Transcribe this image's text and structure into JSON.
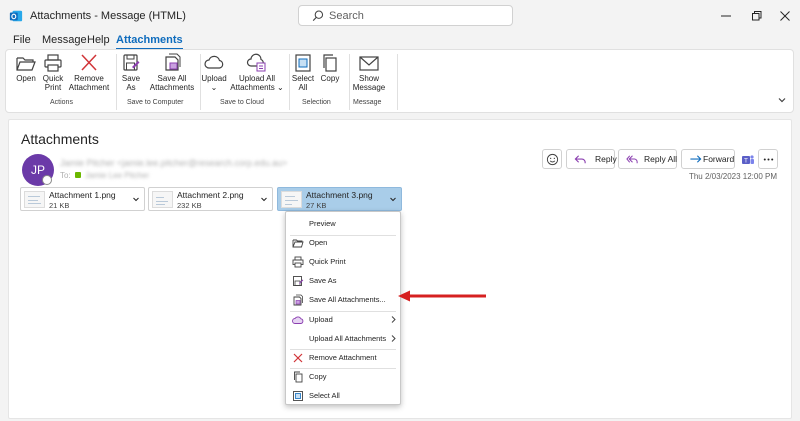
{
  "titlebar": {
    "window_title": "Attachments - Message (HTML)",
    "search_placeholder": "Search",
    "app_icon": "outlook-icon",
    "window_controls": [
      "minimize-icon",
      "restore-icon",
      "close-icon"
    ]
  },
  "menu": {
    "tabs": [
      {
        "label": "File",
        "active": false
      },
      {
        "label": "Message",
        "active": false
      },
      {
        "label": "Help",
        "active": false
      },
      {
        "label": "Attachments",
        "active": true
      }
    ]
  },
  "ribbon": {
    "groups": [
      {
        "label": "Actions",
        "buttons": [
          {
            "label_lines": [
              "Open"
            ],
            "icon": "folder-open-icon"
          },
          {
            "label_lines": [
              "Quick",
              "Print"
            ],
            "icon": "printer-icon"
          },
          {
            "label_lines": [
              "Remove",
              "Attachment"
            ],
            "icon": "remove-x-icon"
          }
        ]
      },
      {
        "label": "Save to Computer",
        "buttons": [
          {
            "label_lines": [
              "Save",
              "As"
            ],
            "icon": "save-as-icon"
          },
          {
            "label_lines": [
              "Save All",
              "Attachments"
            ],
            "icon": "save-all-icon"
          }
        ]
      },
      {
        "label": "Save to Cloud",
        "buttons": [
          {
            "label_lines": [
              "Upload",
              "⌄"
            ],
            "icon": "cloud-upload-icon"
          },
          {
            "label_lines": [
              "Upload All",
              "Attachments ⌄"
            ],
            "icon": "cloud-upload-all-icon"
          }
        ]
      },
      {
        "label": "Selection",
        "buttons": [
          {
            "label_lines": [
              "Select",
              "All"
            ],
            "icon": "select-all-icon"
          },
          {
            "label_lines": [
              "Copy"
            ],
            "icon": "copy-icon"
          }
        ]
      },
      {
        "label": "Message",
        "buttons": [
          {
            "label_lines": [
              "Show",
              "Message"
            ],
            "icon": "envelope-icon"
          }
        ]
      }
    ]
  },
  "message": {
    "heading": "Attachments",
    "avatar_initials": "JP",
    "sender": "Jamie Pitcher <jamie.lee.pitcher@research.corp.edu.au>",
    "recipient_label": "To:",
    "recipient": "Jamie Lee Pitcher",
    "date": "Thu 2/03/2023 12:00 PM",
    "actions": [
      {
        "label": "",
        "icon": "emoji-icon"
      },
      {
        "label": "Reply",
        "icon": "reply-icon"
      },
      {
        "label": "Reply All",
        "icon": "reply-all-icon"
      },
      {
        "label": "Forward",
        "icon": "forward-icon"
      },
      {
        "label": "",
        "icon": "teams-icon"
      },
      {
        "label": "",
        "icon": "more-icon"
      }
    ]
  },
  "attachments": [
    {
      "name": "Attachment 1.png",
      "size": "21 KB",
      "selected": false
    },
    {
      "name": "Attachment 2.png",
      "size": "232 KB",
      "selected": false
    },
    {
      "name": "Attachment 3.png",
      "size": "27 KB",
      "selected": true
    }
  ],
  "context_menu": {
    "items": [
      {
        "label": "Preview",
        "icon": "",
        "submenu": false
      },
      {
        "label": "Open",
        "icon": "folder-open-icon",
        "submenu": false
      },
      {
        "label": "Quick Print",
        "icon": "printer-icon",
        "submenu": false
      },
      {
        "label": "Save As",
        "icon": "save-as-icon",
        "submenu": false
      },
      {
        "label": "Save All Attachments...",
        "icon": "save-all-icon",
        "submenu": false
      },
      {
        "label": "Upload",
        "icon": "cloud-upload-icon",
        "submenu": true
      },
      {
        "label": "Upload All Attachments",
        "icon": "",
        "submenu": true
      },
      {
        "label": "Remove Attachment",
        "icon": "remove-x-icon",
        "submenu": false
      },
      {
        "label": "Copy",
        "icon": "copy-icon",
        "submenu": false
      },
      {
        "label": "Select All",
        "icon": "select-all-icon",
        "submenu": false
      }
    ]
  },
  "colors": {
    "accent": "#0f6cbd",
    "selected_attachment": "#a9cde9",
    "avatar": "#6b3aa8",
    "annotation_arrow": "#d62020",
    "ribbon_icon_purple": "#8b3fb0",
    "ribbon_icon_red": "#d13438"
  }
}
